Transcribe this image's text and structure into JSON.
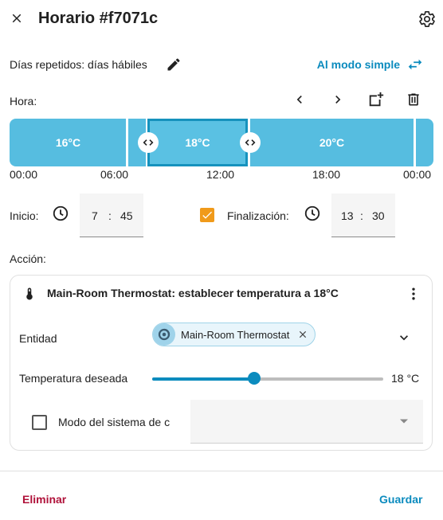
{
  "header": {
    "title": "Horario #f7071c",
    "close_icon": "close-icon",
    "settings_icon": "gear-icon"
  },
  "repeat": {
    "text": "Días repetidos: días hábiles",
    "edit_icon": "pencil-icon",
    "simple_mode_label": "Al modo simple"
  },
  "timeline": {
    "label": "Hora:",
    "blocks": [
      {
        "label": "16°C",
        "start": "00:00",
        "end": "08:00"
      },
      {
        "label": "18°C",
        "start": "08:00",
        "end": "13:30",
        "selected": true
      },
      {
        "label": "20°C",
        "start": "13:30",
        "end": "24:00"
      }
    ],
    "ticks": [
      "00:00",
      "06:00",
      "12:00",
      "18:00",
      "00:00"
    ]
  },
  "time": {
    "start_label": "Inicio:",
    "start_hour": "7",
    "start_minute": "45",
    "end_label": "Finalización:",
    "end_checked": true,
    "end_hour": "13",
    "end_minute": "30",
    "separator": ":"
  },
  "action": {
    "label": "Acción:",
    "title": "Main-Room Thermostat: establecer temperatura a 18°C",
    "entity_label": "Entidad",
    "entity_chip": "Main-Room Thermostat",
    "target_label": "Temperatura deseada",
    "target_value": "18 °C",
    "target_fraction": 0.44,
    "mode_label": "Modo del sistema de c"
  },
  "footer": {
    "delete_label": "Eliminar",
    "save_label": "Guardar"
  },
  "colors": {
    "accent": "#0b8bbe",
    "timeline": "#56bde0",
    "checkbox": "#f09a1a",
    "danger": "#b0123a"
  }
}
